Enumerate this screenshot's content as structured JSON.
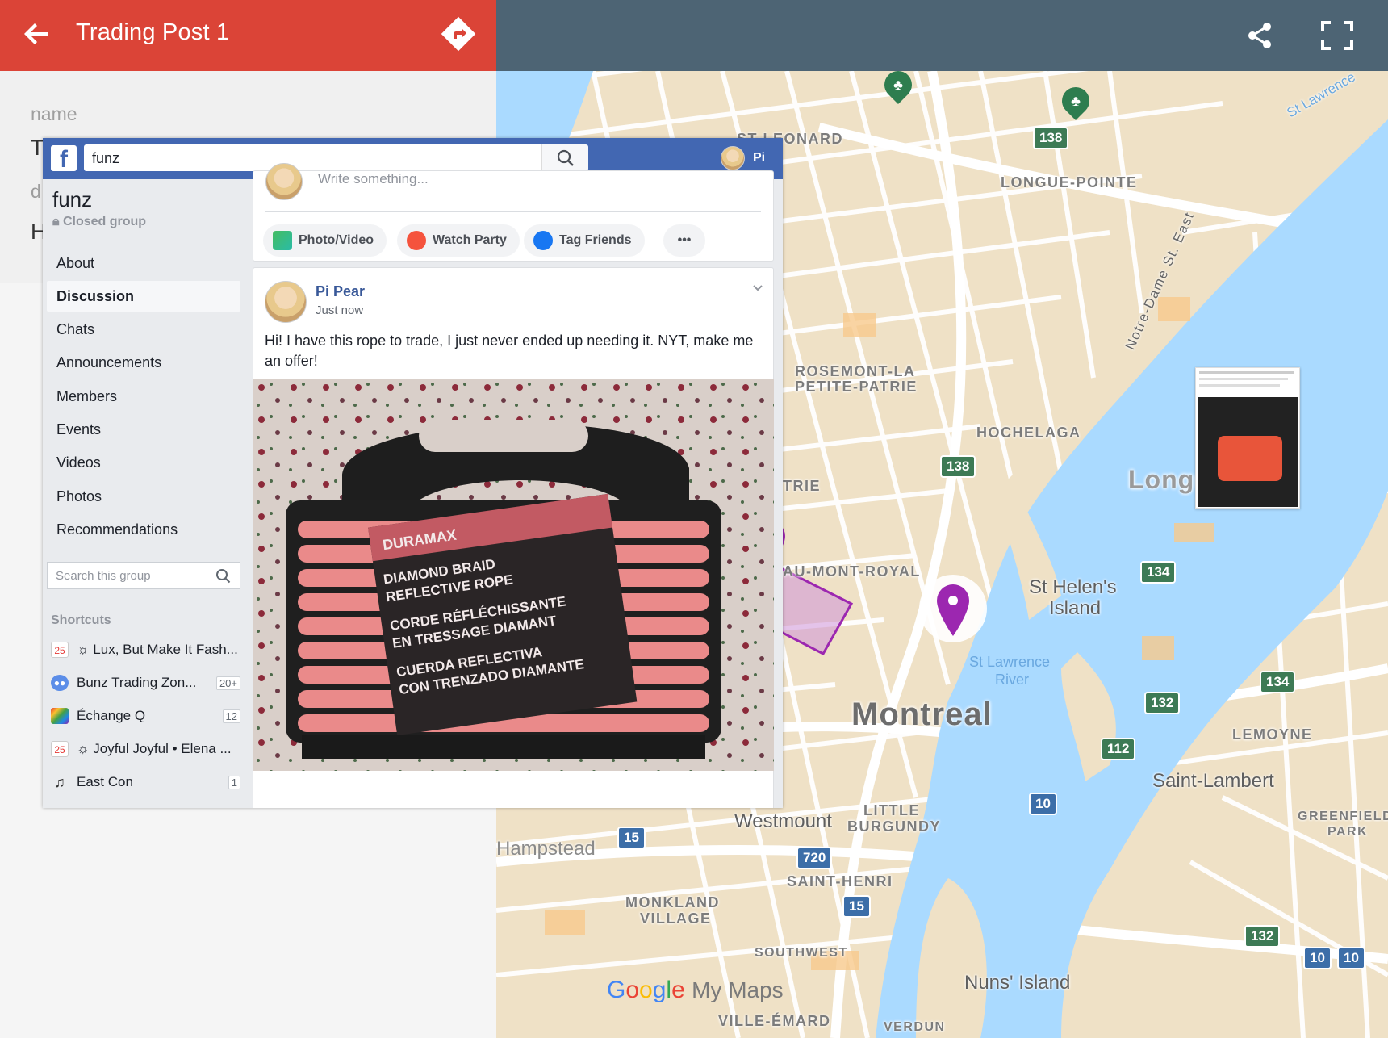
{
  "detail": {
    "title": "Trading Post 1",
    "name_label": "name",
    "name_value_partial": "T",
    "desc_label_partial": "d",
    "desc_value_partial": "H"
  },
  "map": {
    "neighbourhoods": [
      "ST-LEONARD",
      "LONGUE-POINTE",
      "ROSEMONT-LA",
      "PETITE-PATRIE",
      "HOCHELAGA",
      "TRIE",
      "AU-MONT-ROYAL",
      "LITTLE",
      "BURGUNDY",
      "SAINT-HENRI",
      "MONKLAND",
      "VILLAGE",
      "SOUTHWEST",
      "VILLE-ÉMARD",
      "VERDUN",
      "LEMOYNE",
      "GREENFIELD",
      "PARK"
    ],
    "streets": [
      "Notre-Dame St. East",
      "St Lawrence"
    ],
    "city": "Montreal",
    "city_partial": "Longu",
    "places": [
      "St Helen's",
      "Island",
      "Westmount",
      "Hampstead",
      "Saint-Lambert",
      "Nuns' Island"
    ],
    "water": [
      "St Lawrence",
      "River"
    ],
    "shields": [
      "138",
      "138",
      "134",
      "134",
      "132",
      "112",
      "10",
      "15",
      "720",
      "15",
      "132",
      "10",
      "10"
    ],
    "logo_google": "Google",
    "logo_mymaps": "My Maps"
  },
  "fb": {
    "search_value": "funz",
    "user_name": "Pi",
    "group_name": "funz",
    "group_type": "Closed group",
    "nav": [
      "About",
      "Discussion",
      "Chats",
      "Announcements",
      "Members",
      "Events",
      "Videos",
      "Photos",
      "Recommendations"
    ],
    "active_nav": "Discussion",
    "group_search_placeholder": "Search this group",
    "shortcuts_heading": "Shortcuts",
    "shortcuts": [
      {
        "label": "☼ Lux, But Make It Fash...",
        "count": "",
        "icon": "calendar-icon"
      },
      {
        "label": "Bunz Trading Zon...",
        "count": "20+",
        "icon": "group-icon"
      },
      {
        "label": "Échange Q",
        "count": "12",
        "icon": "rainbow-icon"
      },
      {
        "label": "☼ Joyful Joyful • Elena ...",
        "count": "",
        "icon": "calendar-icon"
      },
      {
        "label": "East Con",
        "count": "1",
        "icon": "music-note-icon"
      }
    ],
    "composer": {
      "placeholder": "Write something...",
      "actions": [
        "Photo/Video",
        "Watch Party",
        "Tag Friends"
      ]
    },
    "post": {
      "author": "Pi Pear",
      "time": "Just now",
      "text": "Hi! I have this rope to trade, I just never ended up needing it. NYT, make me an offer!"
    },
    "rope_package": {
      "brand": "DURAMAX",
      "line1": "DIAMOND BRAID",
      "line2": "REFLECTIVE ROPE",
      "line3": "CORDE RÉFLÉCHISSANTE",
      "line4": "EN TRESSAGE DIAMANT",
      "line5": "CUERDA REFLECTIVA",
      "line6": "CON TRENZADO DIAMANTE"
    }
  },
  "colors": {
    "header_red": "#db4437",
    "map_header": "#4d6474",
    "fb_blue": "#4267b2",
    "marker_purple": "#9c27b0",
    "water": "#aadaff"
  }
}
